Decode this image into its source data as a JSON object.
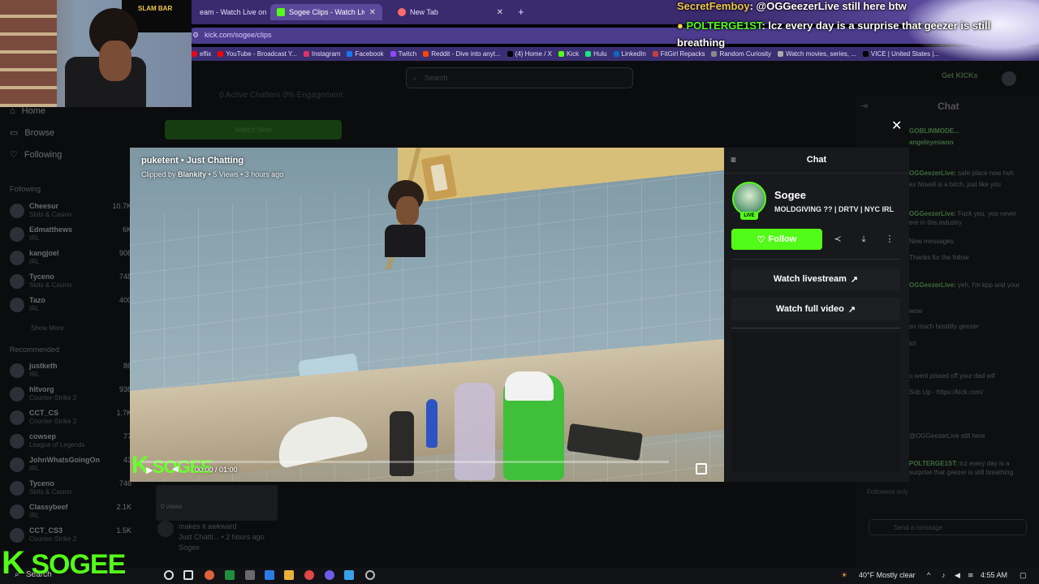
{
  "browser": {
    "tabs": [
      {
        "label": "eam - Watch Live on K",
        "color": "#53fc18"
      },
      {
        "label": "Sogee Clips - Watch Live on Kick",
        "color": "#53fc18"
      },
      {
        "label": "New Tab",
        "color": "#ff6b6b"
      }
    ],
    "url": "kick.com/sogee/clips",
    "bookmarks": [
      {
        "label": "eflix",
        "color": "#e50914"
      },
      {
        "label": "YouTube - Broadcast Y...",
        "color": "#ff0000"
      },
      {
        "label": "Instagram",
        "color": "#e1306c"
      },
      {
        "label": "Facebook",
        "color": "#1877f2"
      },
      {
        "label": "Twitch",
        "color": "#9146ff"
      },
      {
        "label": "Reddit - Dive into anyt...",
        "color": "#ff4500"
      },
      {
        "label": "(4) Home / X",
        "color": "#000000"
      },
      {
        "label": "Kick",
        "color": "#53fc18"
      },
      {
        "label": "Hulu",
        "color": "#1ce783"
      },
      {
        "label": "LinkedIn",
        "color": "#0a66c2"
      },
      {
        "label": "FitGirl Repacks",
        "color": "#c04040"
      },
      {
        "label": "Random Curiosity",
        "color": "#888888"
      },
      {
        "label": "Watch movies, series, ...",
        "color": "#aaaaaa"
      },
      {
        "label": "VICE | United States |...",
        "color": "#000000"
      }
    ]
  },
  "background_page": {
    "search_placeholder": "Search",
    "get_kicks": "Get KICKs",
    "stats": "0 Active Chatters   0% Engagement",
    "watch_label": "Watch Now",
    "clip": {
      "views": "0 views",
      "title": "makes it awkward",
      "meta": "Just Chatti... • 2 hours ago",
      "author": "Sogee"
    },
    "nav": [
      "Home",
      "Browse",
      "Following"
    ],
    "following_header": "Following",
    "following": [
      {
        "name": "Cheesur",
        "cat": "Slots & Casino",
        "viewers": "10.7K"
      },
      {
        "name": "Edmatthews",
        "cat": "IRL",
        "viewers": "6K"
      },
      {
        "name": "kangjoel",
        "cat": "IRL",
        "viewers": "908"
      },
      {
        "name": "Tyceno",
        "cat": "Slots & Casino",
        "viewers": "748"
      },
      {
        "name": "Tazo",
        "cat": "IRL",
        "viewers": "400"
      }
    ],
    "show_more": "Show More",
    "recommended_header": "Recommended",
    "recommended": [
      {
        "name": "justketh",
        "cat": "IRL",
        "viewers": "86"
      },
      {
        "name": "hltvorg",
        "cat": "Counter-Strike 2",
        "viewers": "938"
      },
      {
        "name": "CCT_CS",
        "cat": "Counter-Strike 2",
        "viewers": "1.7K"
      },
      {
        "name": "cowsep",
        "cat": "League of Legends",
        "viewers": "77"
      },
      {
        "name": "JohnWhatsGoingOn",
        "cat": "IRL",
        "viewers": "43"
      },
      {
        "name": "Tyceno",
        "cat": "Slots & Casino",
        "viewers": "746"
      },
      {
        "name": "Classybeef",
        "cat": "IRL",
        "viewers": "2.1K"
      },
      {
        "name": "CCT_CS3",
        "cat": "Counter-Strike 2",
        "viewers": "1.5K"
      }
    ],
    "chat_title": "Chat",
    "chat_messages": [
      {
        "user": "GOBLINMODE...",
        "text": ""
      },
      {
        "user": "angeleyeswon",
        "text": ""
      },
      {
        "user": "OGGeezerLive:",
        "text": "safe place now huh"
      },
      {
        "user": "",
        "text": "ex Novell is a bitch, just like you"
      },
      {
        "user": "OGGeezerLive:",
        "text": "Fuck you, you never"
      },
      {
        "user": "",
        "text": "ere in this industry"
      },
      {
        "user": "",
        "text": "New messages"
      },
      {
        "user": "",
        "text": "Thanks for the follow"
      },
      {
        "user": "OGGeezerLive:",
        "text": "yeh, I'm kpp and your"
      },
      {
        "user": "",
        "text": "wow"
      },
      {
        "user": "",
        "text": "so much hostility geezer"
      },
      {
        "user": "",
        "text": "lol"
      },
      {
        "user": "",
        "text": "u went pissed off your dad wtf"
      },
      {
        "user": "",
        "text": "Sub Up - https://kick.com/"
      },
      {
        "user": "",
        "text": "@OGGeezerLive still here"
      },
      {
        "user": "POLTERGE1ST:",
        "text": "lcz every day is a surprise that geezer is still breathing"
      }
    ],
    "followers_only": "Followers only",
    "send_placeholder": "Send a message"
  },
  "clip_modal": {
    "channel_category": "puketent • Just Chatting",
    "clipped_by_prefix": "Clipped by",
    "clipped_by": "Blankity",
    "clip_meta": "• 5 Views • 3 hours ago",
    "time": "00:00 / 01:00",
    "progress_fraction": 0.0,
    "watermark": "SOGEE",
    "panel_title": "Chat",
    "streamer": "Sogee",
    "stream_title": "MOLDGIVING ?? | DRTV | NYC IRL",
    "live_badge": "LIVE",
    "follow_label": "Follow",
    "watch_livestream": "Watch livestream",
    "watch_full_video": "Watch full video",
    "accent": "#53fc18"
  },
  "stream_overlay": {
    "chat": [
      {
        "user": "SecretFemboy",
        "text": ": @OGGeezerLive still here btw"
      },
      {
        "user": "POLTERGE1ST",
        "text": ": lcz every day is a surprise that geezer is still"
      },
      {
        "user": "",
        "text": "breathing"
      }
    ],
    "cam_poster": "SLAM BAR",
    "logo": "SOGEE"
  },
  "taskbar": {
    "search": "Search",
    "weather": "40°F  Mostly clear",
    "time": "4:55 AM"
  }
}
